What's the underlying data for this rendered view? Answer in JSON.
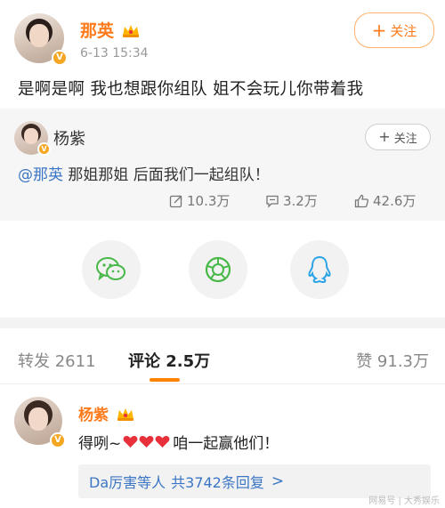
{
  "post": {
    "author": "那英",
    "time": "6-13 15:34",
    "follow_label": "关注",
    "text": "是啊是啊 我也想跟你组队 姐不会玩儿你带着我"
  },
  "retweet": {
    "author": "杨紫",
    "follow_label": "关注",
    "mention": "@那英",
    "text": " 那姐那姐 后面我们一起组队！",
    "stats": {
      "reposts": "10.3万",
      "comments": "3.2万",
      "likes": "42.6万"
    }
  },
  "share": {
    "icons": [
      "wechat-icon",
      "moments-icon",
      "qq-icon"
    ]
  },
  "tabs": {
    "repost_label": "转发",
    "repost_count": "2611",
    "comment_label": "评论",
    "comment_count": "2.5万",
    "like_label": "赞",
    "like_count": "91.3万"
  },
  "comment": {
    "author": "杨紫",
    "text_before": "得咧~",
    "text_after": "咱一起赢他们！",
    "reply_users": "Da厉害等人",
    "reply_count_text": "共3742条回复",
    "reply_arrow": ">"
  },
  "watermark": "网易号 | 大秀娱乐",
  "colors": {
    "accent": "#ff7a1a",
    "link": "#3b76c4",
    "tab_underline": "#ff8200",
    "heart": "#e8303a"
  }
}
